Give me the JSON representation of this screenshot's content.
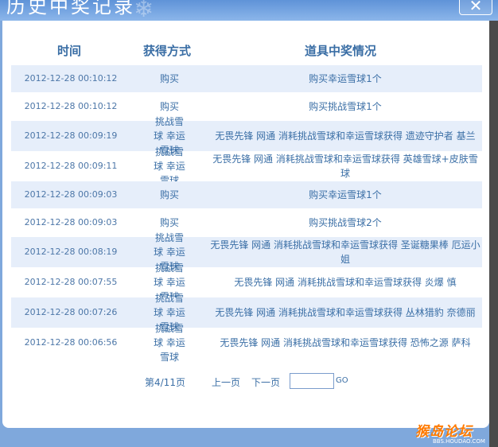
{
  "dialog": {
    "title": "历史中奖记录",
    "close_glyph": "✕"
  },
  "columns": {
    "time": "时间",
    "method": "获得方式",
    "result": "道具中奖情况"
  },
  "records": [
    {
      "time": "2012-12-28 00:10:12",
      "method": "购买",
      "result": "购买幸运雪球1个"
    },
    {
      "time": "2012-12-28 00:10:12",
      "method": "购买",
      "result": "购买挑战雪球1个"
    },
    {
      "time": "2012-12-28 00:09:19",
      "method": "挑战雪球 幸运雪球",
      "result": "无畏先锋 网通 消耗挑战雪球和幸运雪球获得 遗迹守护者 基兰"
    },
    {
      "time": "2012-12-28 00:09:11",
      "method": "挑战雪球 幸运雪球",
      "result": "无畏先锋 网通 消耗挑战雪球和幸运雪球获得 英雄雪球+皮肤雪球"
    },
    {
      "time": "2012-12-28 00:09:03",
      "method": "购买",
      "result": "购买幸运雪球1个"
    },
    {
      "time": "2012-12-28 00:09:03",
      "method": "购买",
      "result": "购买挑战雪球2个"
    },
    {
      "time": "2012-12-28 00:08:19",
      "method": "挑战雪球 幸运雪球",
      "result": "无畏先锋 网通 消耗挑战雪球和幸运雪球获得 圣诞糖果棒 厄运小姐"
    },
    {
      "time": "2012-12-28 00:07:55",
      "method": "挑战雪球 幸运雪球",
      "result": "无畏先锋 网通 消耗挑战雪球和幸运雪球获得 炎爆 慎"
    },
    {
      "time": "2012-12-28 00:07:26",
      "method": "挑战雪球 幸运雪球",
      "result": "无畏先锋 网通 消耗挑战雪球和幸运雪球获得 丛林猎豹 奈德丽"
    },
    {
      "time": "2012-12-28 00:06:56",
      "method": "挑战雪球 幸运雪球",
      "result": "无畏先锋 网通 消耗挑战雪球和幸运雪球获得 恐怖之源 萨科"
    }
  ],
  "pagination": {
    "page_info": "第4/11页",
    "prev_label": "上一页",
    "next_label": "下一页",
    "page_input_value": "",
    "go_label": "GO"
  },
  "watermark": {
    "site_name": "猴岛论坛",
    "site_url": "BBS.HOUDAO.COM"
  }
}
